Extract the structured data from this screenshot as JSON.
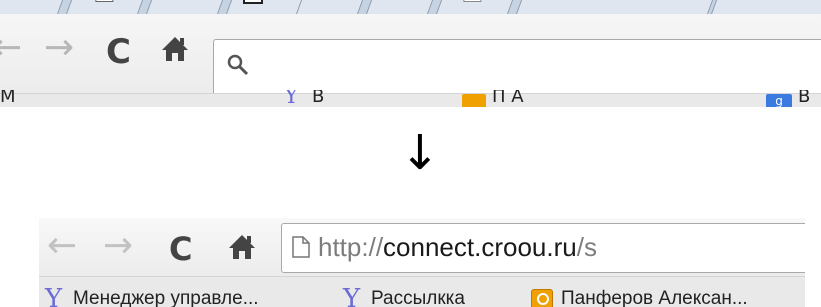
{
  "before": {
    "toolbar": {
      "back_glyph": "←",
      "forward_glyph": "→",
      "reload_glyph": "C",
      "home_glyph": "🏠",
      "search_glyph": "⚲"
    },
    "bookmarks": [
      {
        "icon": "M"
      },
      {
        "icon": "Y",
        "label": "В"
      },
      {
        "icon": "ok",
        "label": "П                       А"
      },
      {
        "icon": "g",
        "label": "В"
      }
    ]
  },
  "arrow": {
    "glyph": "↓"
  },
  "after": {
    "toolbar": {
      "back_glyph": "←",
      "forward_glyph": "→",
      "reload_glyph": "C",
      "home_glyph": "🏠"
    },
    "omnibox": {
      "scheme": "http://",
      "host": "connect.croou.ru",
      "path": "/s"
    },
    "bookmarks": [
      {
        "icon": "Y",
        "label": "Менеджер управле..."
      },
      {
        "icon": "Y",
        "label": "Рассылкка"
      },
      {
        "icon": "ok",
        "label": "Панферов Алексан..."
      }
    ]
  },
  "colors": {
    "tabstrip": "#c6d3e3",
    "toolbar": "#f0f0f0",
    "bookmark_bar": "#e9e9e9",
    "yandex_icon": "#6b6bd6",
    "ok_icon": "#f0a000",
    "url_dim": "#7d7d7d",
    "url_host": "#1a1a1a"
  }
}
